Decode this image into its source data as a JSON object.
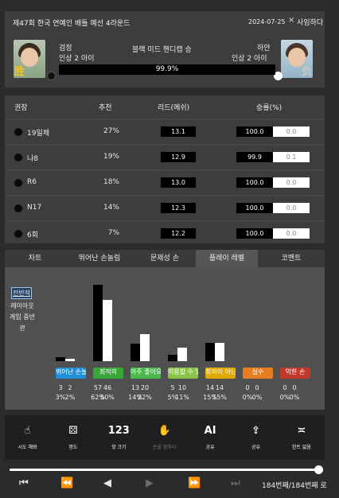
{
  "header": {
    "title": "제47회 한국 연예인 배틀 예선 4라운드",
    "date": "2024-07-25",
    "close_icon": "×",
    "resign_label": "사임하다",
    "black": {
      "name": "검정",
      "level": "인상 2 아이",
      "badge": "胜"
    },
    "white": {
      "name": "하얀",
      "level": "인상 2 아이",
      "badge": "负"
    },
    "result": "블랙 미드 핸디캡 승",
    "winrate_label": "99.9%",
    "winrate_value": 99.9
  },
  "table": {
    "headers": {
      "player": "권장",
      "recommend": "추천",
      "lead": "리드(메쉬)",
      "winrate": "승률(%)"
    },
    "rows": [
      {
        "move": "19일체",
        "rec": "27%",
        "lead": "13.1",
        "wr_black": "100.0",
        "wr_white": "0.0"
      },
      {
        "move": "나8",
        "rec": "19%",
        "lead": "12.9",
        "wr_black": "99.9",
        "wr_white": "0.1"
      },
      {
        "move": "R6",
        "rec": "18%",
        "lead": "13.0",
        "wr_black": "100.0",
        "wr_white": "0.0"
      },
      {
        "move": "N17",
        "rec": "14%",
        "lead": "12.3",
        "wr_black": "100.0",
        "wr_white": "0.0"
      },
      {
        "move": "6회",
        "rec": "7%",
        "lead": "12.2",
        "wr_black": "100.0",
        "wr_white": "0.0"
      }
    ]
  },
  "tabs": [
    "차트",
    "뛰어난 손놀림",
    "문제성 손",
    "플레이 레벨",
    "코멘트"
  ],
  "active_tab": 3,
  "side_labels": {
    "primary": "전반적",
    "secondary": "레이아웃 게임 중반 관"
  },
  "chart_data": {
    "type": "bar",
    "categories": [
      "뛰어난 손놀림",
      "최적의",
      "아주 좋아요",
      "이용할 수 있는",
      "최적이 아닌",
      "실수",
      "악한 손"
    ],
    "category_colors": [
      "#1e8fd8",
      "#3aa63a",
      "#4cb84c",
      "#8bc34a",
      "#e0a800",
      "#e67e22",
      "#c0392b"
    ],
    "series": [
      {
        "name": "검정",
        "color": "#000000",
        "counts": [
          3,
          57,
          13,
          5,
          14,
          0,
          0
        ],
        "values": [
          3,
          62,
          14,
          5,
          15,
          0,
          0
        ]
      },
      {
        "name": "하얀",
        "color": "#ffffff",
        "counts": [
          2,
          46,
          20,
          10,
          14,
          0,
          0
        ],
        "values": [
          2,
          50,
          22,
          11,
          15,
          0,
          0
        ]
      }
    ],
    "unit": "%"
  },
  "toolbar": [
    {
      "icon": "touch-icon",
      "glyph": "☝",
      "label": "시도 해봐",
      "enabled": true
    },
    {
      "icon": "dice-icon",
      "glyph": "⚄",
      "label": "명도",
      "enabled": true
    },
    {
      "icon": "number-icon",
      "glyph": "123",
      "label": "핫 크기",
      "enabled": true
    },
    {
      "icon": "hand-icon",
      "glyph": "✋",
      "label": "손을 멈추다",
      "enabled": false
    },
    {
      "icon": "ai-icon",
      "glyph": "AI",
      "label": "공유",
      "enabled": true
    },
    {
      "icon": "share-icon",
      "glyph": "⇪",
      "label": "공유",
      "enabled": true
    },
    {
      "icon": "hint-icon",
      "glyph": "≍",
      "label": "힌트 없음",
      "enabled": true
    }
  ],
  "playback": {
    "progress_value": 1.0,
    "counter": "184번째/184번째 로",
    "buttons": [
      {
        "name": "first-move-button",
        "glyph": "⏮",
        "enabled": true
      },
      {
        "name": "back-ten-button",
        "glyph": "⏪",
        "enabled": true
      },
      {
        "name": "prev-move-button",
        "glyph": "◀",
        "enabled": true
      },
      {
        "name": "next-move-button",
        "glyph": "▶",
        "enabled": false
      },
      {
        "name": "forward-ten-button",
        "glyph": "⏩",
        "enabled": false
      },
      {
        "name": "last-move-button",
        "glyph": "⏭",
        "enabled": false
      }
    ]
  }
}
